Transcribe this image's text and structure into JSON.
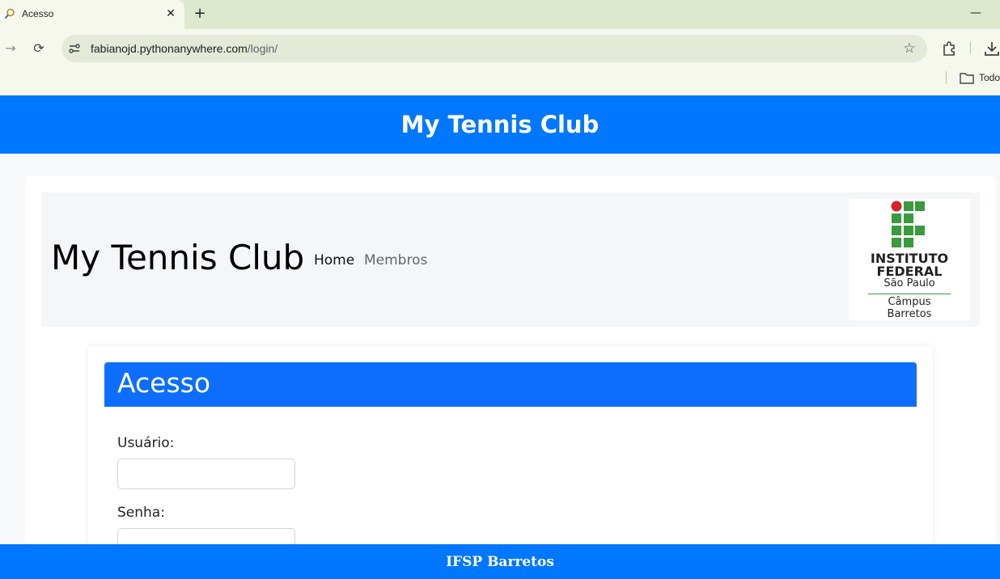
{
  "browser": {
    "tab_title": "Acesso",
    "tab_close": "✕",
    "new_tab": "+",
    "minimize": "—",
    "back": "→",
    "reload": "⟳",
    "url_host": "fabianojd.pythonanywhere.com",
    "url_path": "/login/",
    "bookmark_label": "Todo",
    "star": "☆",
    "icons": [
      "magnifier-favicon",
      "site-info-icon",
      "star-icon",
      "extensions-icon",
      "download-icon",
      "folder-icon"
    ]
  },
  "header": {
    "title": "My Tennis Club",
    "color": "#0077ff"
  },
  "navbar": {
    "brand": "My Tennis Club",
    "links": [
      "Home",
      "Membros"
    ]
  },
  "logo": {
    "line1": "INSTITUTO",
    "line2": "FEDERAL",
    "line3": "São Paulo",
    "line4": "Câmpus",
    "line5": "Barretos",
    "green": "#3a9a3e",
    "red": "#d3242a"
  },
  "login": {
    "title": "Acesso",
    "username_label": "Usuário:",
    "password_label": "Senha:",
    "username_value": "",
    "password_value": "",
    "accent": "#0d6efd"
  },
  "footer": {
    "text": "IFSP Barretos"
  }
}
